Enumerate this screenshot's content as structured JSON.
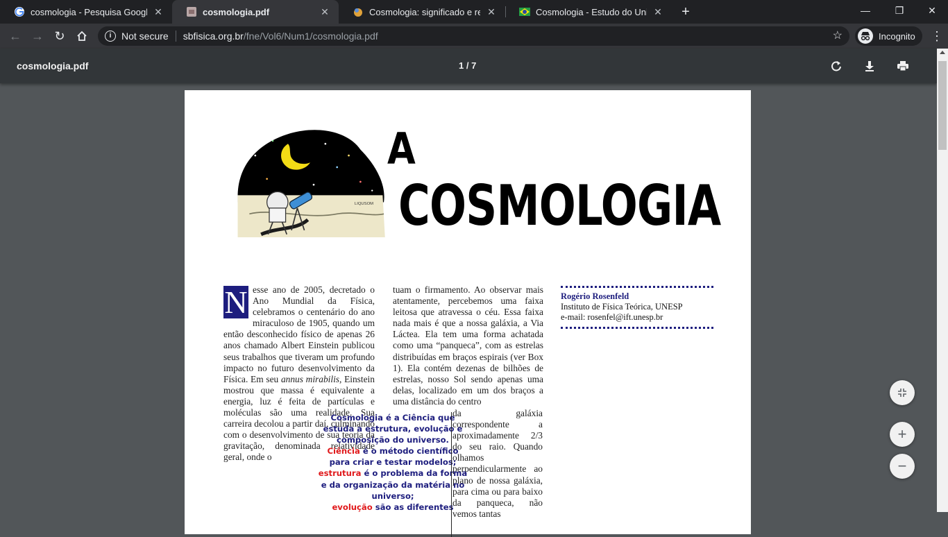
{
  "tabs": [
    {
      "label": "cosmologia - Pesquisa Google",
      "icon": "google-icon",
      "active": false
    },
    {
      "label": "cosmologia.pdf",
      "icon": "pdf-file-icon",
      "active": true
    },
    {
      "label": "Cosmologia: significado e relação",
      "icon": "site-favicon-icon",
      "active": false
    },
    {
      "label": "Cosmologia - Estudo do Universo",
      "icon": "brazil-flag-icon",
      "active": false
    }
  ],
  "window_controls": {
    "minimize": "—",
    "restore": "❐",
    "close": "✕"
  },
  "omnibox": {
    "security_label": "Not secure",
    "host": "sbfisica.org.br",
    "path": "/fne/Vol6/Num1/cosmologia.pdf"
  },
  "incognito_label": "Incognito",
  "pdf_viewer": {
    "title": "cosmologia.pdf",
    "page_indicator": "1 / 7"
  },
  "article": {
    "title_small": "A",
    "title_big": "COSMOLOGIA",
    "illustration_signature": "LIQUSOM",
    "dropcap": "N",
    "col1_text": "esse ano de 2005, decretado o Ano Mundial da Física, celebramos o centenário do ano miraculoso de 1905, quando um então desconhecido físico de apenas 26 anos chamado Albert Einstein publicou seus trabalhos que tiveram um profundo impacto no futuro desenvolvimento da Física. Em seu",
    "col1_italic": "annus mirabilis",
    "col1_text_after": ", Einstein mostrou que massa é equivalente a energia, luz é feita de partículas e moléculas são uma realidade. Sua carreira decolou a partir daí, culminando com o desenvolvimento de sua teoria da gravitação, denominada relatividade geral, onde o",
    "col2_text": "tuam o firmamento. Ao observar mais atentamente, percebemos uma faixa leitosa que atravessa o céu. Essa faixa nada mais é que a nossa galáxia, a Via Láctea. Ela tem uma forma achatada como uma “panqueca”, com as estrelas distribuídas em braços espirais (ver Box 1). Ela contém dezenas de bilhões de estrelas, nosso Sol sendo apenas uma delas, localizado em um dos braços a uma distância do centro",
    "col2_text_narrow": "da galáxia correspondente a aproximadamente 2/3 do seu raio. Quando olhamos perpendicularmente ao plano de nossa galáxia, para cima ou para baixo da panqueca, não vemos tantas",
    "author": {
      "name": "Rogério Rosenfeld",
      "institute": "Instituto de Física Teórica, UNESP",
      "email": "e-mail:  rosenfel@ift.unesp.br"
    },
    "callout": {
      "line1": "Cosmologia é a Ciência que estuda a estrutura, evolução e composição do universo.",
      "term1": "Ciência",
      "def1": " é o método científico para criar e testar modelos;",
      "term2": "estrutura",
      "def2": " é o problema da forma e da organização da matéria no universo;",
      "term3": "evolução",
      "def3": " são as diferentes"
    }
  },
  "colors": {
    "accent_blue": "#1d1d7e",
    "highlight_red": "#e0191b",
    "viewer_bg": "#525659",
    "toolbar_bg": "#323639"
  }
}
